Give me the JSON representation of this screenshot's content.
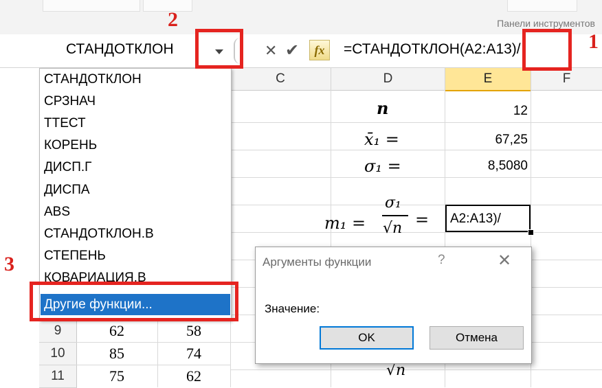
{
  "ribbon": {
    "group_label": "Панели инструментов"
  },
  "formula_bar": {
    "name_box_value": "СТАНДОТКЛОН",
    "cancel_icon": "close-icon",
    "enter_icon": "check-icon",
    "fx_label": "fx",
    "formula": "=СТАНДОТКЛОН(A2:A13)/"
  },
  "columns": [
    "C",
    "D",
    "E",
    "F"
  ],
  "selected_column": "E",
  "worksheet": {
    "n_label": "n",
    "n_value": "12",
    "mean_label": "x̄₁ =",
    "mean_value": "67,25",
    "sigma_label": "σ₁ =",
    "sigma_value": "8,5080",
    "m_lhs": "m₁ =",
    "m_num": "σ₁",
    "m_den": "√n",
    "m_eq": "=",
    "active_cell_value": "A2:A13)/",
    "second_den": "√n"
  },
  "function_dropdown": {
    "items": [
      "СТАНДОТКЛОН",
      "СРЗНАЧ",
      "ТТЕСТ",
      "КОРЕНЬ",
      "ДИСП.Г",
      "ДИСПА",
      "ABS",
      "СТАНДОТКЛОН.В",
      "СТЕПЕНЬ",
      "КОВАРИАЦИЯ.В"
    ],
    "more_functions": "Другие функции..."
  },
  "rows": [
    {
      "num": "9",
      "a": "62",
      "b": "58"
    },
    {
      "num": "10",
      "a": "85",
      "b": "74"
    },
    {
      "num": "11",
      "a": "75",
      "b": "62"
    }
  ],
  "dialog": {
    "title": "Аргументы функции",
    "help": "?",
    "close": "✕",
    "value_label": "Значение:",
    "ok_label": "OK",
    "cancel_label": "Отмена"
  },
  "callouts": {
    "one": "1",
    "two": "2",
    "three": "3"
  },
  "colors": {
    "highlight_red": "#e52420",
    "selection_blue": "#1e73c8",
    "selected_column_header": "#ffe697"
  }
}
